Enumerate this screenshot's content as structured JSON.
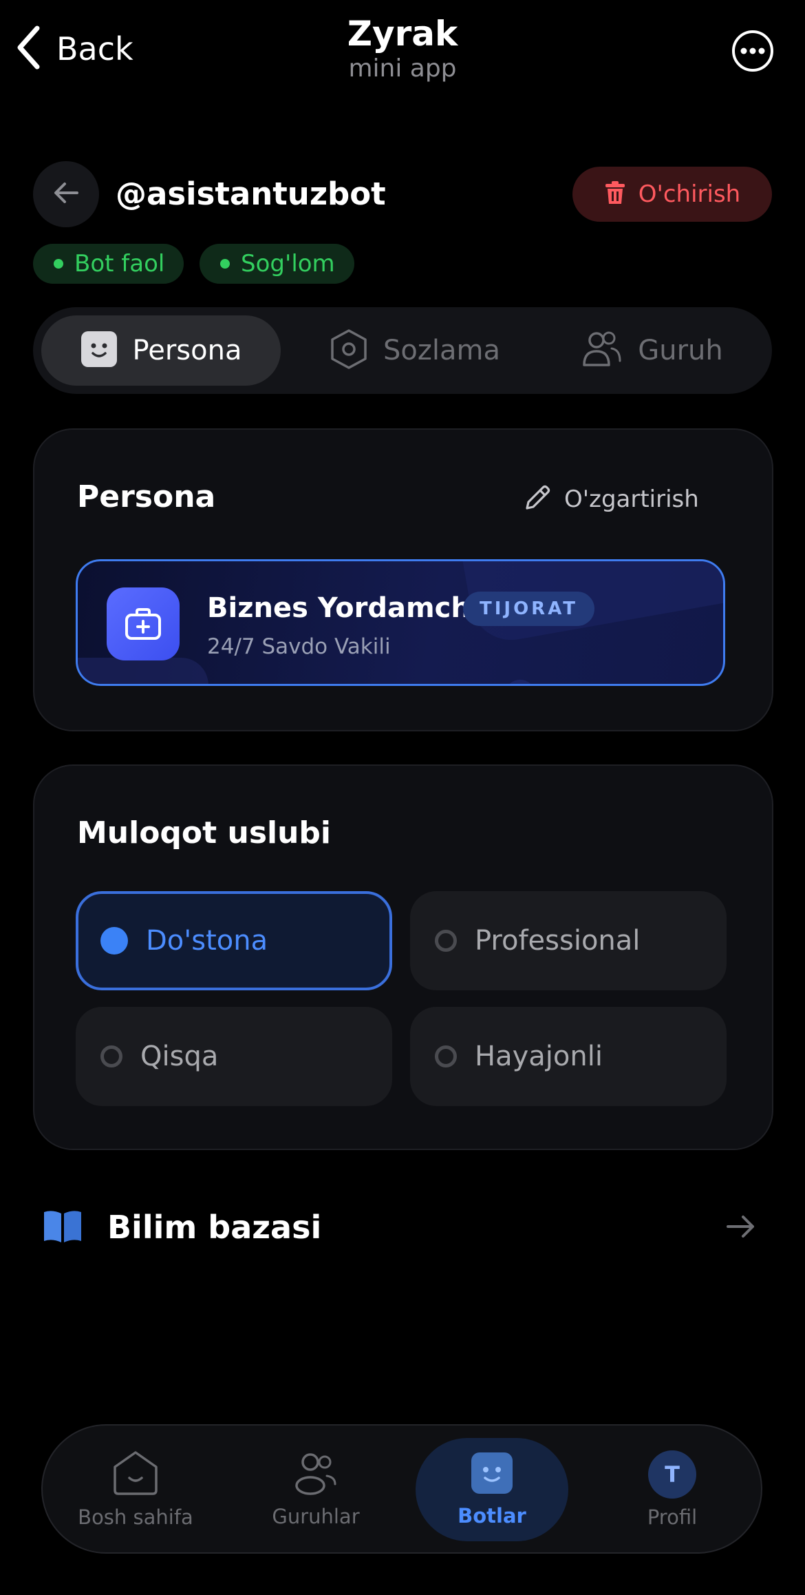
{
  "topbar": {
    "back_label": "Back",
    "title": "Zyrak",
    "subtitle": "mini app",
    "more_icon": "ellipsis-circle-icon"
  },
  "bot": {
    "username": "@asistantuzbot",
    "delete_label": "O'chirish",
    "badges": [
      {
        "label": "Bot faol",
        "color": "#33cf5f"
      },
      {
        "label": "Sog'lom",
        "color": "#33cf5f"
      }
    ]
  },
  "tabs": [
    {
      "label": "Persona",
      "icon": "face-icon",
      "active": true
    },
    {
      "label": "Sozlama",
      "icon": "hexagon-settings-icon",
      "active": false
    },
    {
      "label": "Guruh",
      "icon": "users-icon",
      "active": false
    }
  ],
  "persona_card": {
    "title": "Persona",
    "edit_label": "O'zgartirish",
    "item": {
      "name": "Biznes Yordamchi",
      "tag": "TIJORAT",
      "subtitle": "24/7 Savdo Vakili",
      "icon": "briefcase-medical-icon"
    }
  },
  "style_card": {
    "title": "Muloqot uslubi",
    "options": [
      {
        "label": "Do'stona",
        "selected": true
      },
      {
        "label": "Professional",
        "selected": false
      },
      {
        "label": "Qisqa",
        "selected": false
      },
      {
        "label": "Hayajonli",
        "selected": false
      }
    ]
  },
  "knowledge": {
    "label": "Bilim bazasi",
    "icon": "book-icon",
    "arrow_icon": "arrow-right-icon"
  },
  "bottom_nav": [
    {
      "label": "Bosh sahifa",
      "icon": "home-icon",
      "active": false
    },
    {
      "label": "Guruhlar",
      "icon": "users-icon",
      "active": false
    },
    {
      "label": "Botlar",
      "icon": "bot-face-icon",
      "active": true
    },
    {
      "label": "Profil",
      "icon": "avatar",
      "avatar_letter": "T",
      "active": false
    }
  ],
  "colors": {
    "accent": "#3b82f6",
    "danger": "#ff5a5f",
    "success": "#33cf5f",
    "background": "#000000"
  }
}
